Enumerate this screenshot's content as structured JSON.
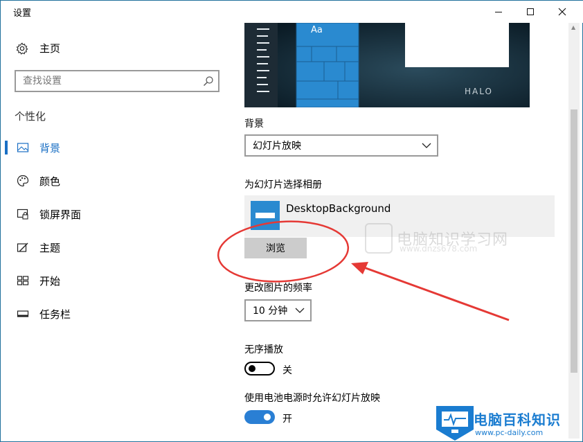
{
  "window": {
    "title": "设置",
    "controls": {
      "minimize": "minimize-icon",
      "maximize": "maximize-icon",
      "close": "close-icon"
    }
  },
  "sidebar": {
    "home_label": "主页",
    "search_placeholder": "查找设置",
    "section_label": "个性化",
    "items": [
      {
        "label": "背景",
        "icon": "picture-icon",
        "active": true
      },
      {
        "label": "颜色",
        "icon": "palette-icon",
        "active": false
      },
      {
        "label": "锁屏界面",
        "icon": "lock-screen-icon",
        "active": false
      },
      {
        "label": "主题",
        "icon": "theme-brush-icon",
        "active": false
      },
      {
        "label": "开始",
        "icon": "start-tiles-icon",
        "active": false
      },
      {
        "label": "任务栏",
        "icon": "taskbar-icon",
        "active": false
      }
    ],
    "accent_color": "#1a6fc4"
  },
  "preview": {
    "tile_text": "Aa",
    "logo_text": "HALO"
  },
  "main": {
    "background_label": "背景",
    "background_value": "幻灯片放映",
    "album_label": "为幻灯片选择相册",
    "album_name": "DesktopBackground",
    "browse_label": "浏览",
    "frequency_label": "更改图片的频率",
    "frequency_value": "10 分钟",
    "shuffle_label": "无序播放",
    "shuffle_state": "关",
    "shuffle_on": false,
    "battery_label": "使用电池电源时允许幻灯片放映",
    "battery_state": "开",
    "battery_on": true
  },
  "watermark": {
    "text": "电脑知识学习网",
    "url": "www.dnzs678.com"
  },
  "badge": {
    "title": "电脑百科知识",
    "url": "www.pc-daily.com"
  },
  "colors": {
    "accent": "#2a7fd4",
    "annotation_red": "#e53935",
    "tile_blue": "#2a8ad0"
  }
}
